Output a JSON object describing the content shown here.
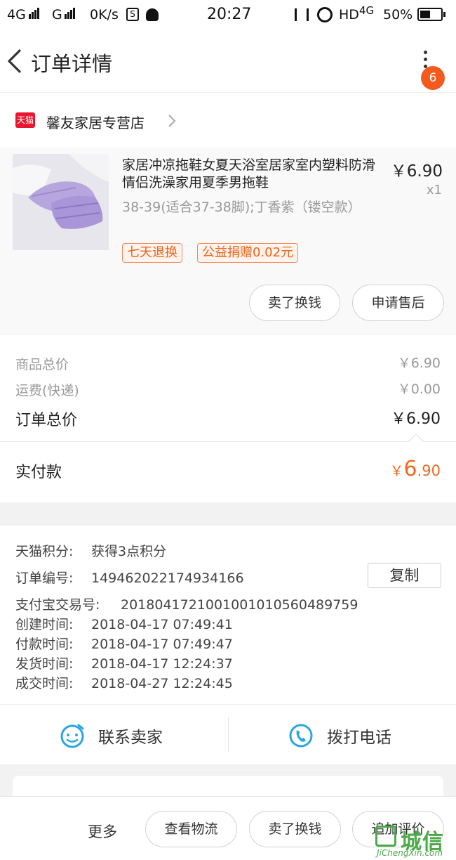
{
  "status_bar": {
    "network1": "4G",
    "network2": "G",
    "speed": "0K/s",
    "time": "20:27",
    "hd": "HD",
    "net_right": "4G",
    "battery": "50%"
  },
  "header": {
    "title": "订单详情",
    "badge_count": "6"
  },
  "shop": {
    "icon_text": "天猫",
    "name": "馨友家居专营店"
  },
  "product": {
    "title": "家居冲凉拖鞋女夏天浴室居家室内塑料防滑情侣洗澡家用夏季男拖鞋",
    "price": "￥6.90",
    "quantity": "x1",
    "spec": "38-39(适合37-38脚);丁香紫（镂空款）",
    "tags": [
      "七天退换",
      "公益捐赠0.02元"
    ],
    "sell_button": "卖了换钱",
    "after_sale_button": "申请售后"
  },
  "summary": {
    "goods_total_label": "商品总价",
    "goods_total_value": "￥6.90",
    "shipping_label": "运费(快递)",
    "shipping_value": "￥0.00",
    "order_total_label": "订单总价",
    "order_total_value": "￥6.90",
    "paid_label": "实付款",
    "paid_currency": "￥",
    "paid_integer": "6",
    "paid_decimal": ".90"
  },
  "order_info": {
    "rows": [
      {
        "key": "天猫积分:",
        "value": "获得3点积分"
      },
      {
        "key": "订单编号:",
        "value": "149462022174934166"
      },
      {
        "key": "支付宝交易号:",
        "value": "2018041721001001010560489759"
      },
      {
        "key": "创建时间:",
        "value": "2018-04-17 07:49:41"
      },
      {
        "key": "付款时间:",
        "value": "2018-04-17 07:49:47"
      },
      {
        "key": "发货时间:",
        "value": "2018-04-17 12:24:37"
      },
      {
        "key": "成交时间:",
        "value": "2018-04-27 12:24:45"
      }
    ],
    "copy_button": "复制"
  },
  "contact": {
    "seller": "联系卖家",
    "phone": "拨打电话"
  },
  "bottom_bar": {
    "more": "更多",
    "logistics": "查看物流",
    "sell": "卖了换钱",
    "review": "追加评价"
  },
  "watermark": {
    "text": "城信",
    "sub": "JiChengXin.com"
  },
  "colors": {
    "accent_orange": "#f06a23",
    "badge": "#f35a1e",
    "tmall_red": "#e8162f",
    "icon_blue": "#2aa6e0",
    "watermark_green": "#4aaa48"
  }
}
